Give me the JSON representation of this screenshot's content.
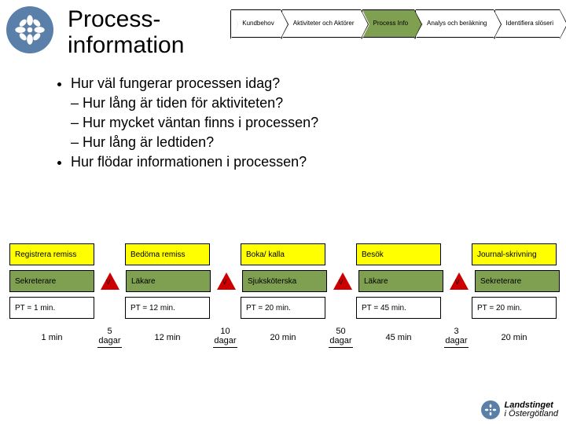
{
  "title_line1": "Process-",
  "title_line2": "information",
  "nav": {
    "step1": "Kundbehov",
    "step2": "Aktiviteter och Aktörer",
    "step3": "Process Info",
    "step4": "Analys och beräkning",
    "step5": "Identifiera slöseri"
  },
  "bullets": {
    "q1": "Hur väl fungerar processen idag?",
    "q1a": "Hur lång är tiden för aktiviteten?",
    "q1b": "Hur mycket väntan finns i processen?",
    "q1c": "Hur lång är ledtiden?",
    "q2": "Hur flödar informationen i processen?"
  },
  "flow": {
    "headers": [
      "Registrera remiss",
      "Bedöma remiss",
      "Boka/ kalla",
      "Besök",
      "Journal-skrivning"
    ],
    "actors": [
      "Sekreterare",
      "Läkare",
      "Sjuksköterska",
      "Läkare",
      "Sekreterare"
    ],
    "pt": [
      "PT = 1 min.",
      "PT = 12 min.",
      "PT = 20 min.",
      "PT = 45 min.",
      "PT = 20 min."
    ],
    "pt_short": [
      "1 min",
      "12 min",
      "20 min",
      "45 min",
      "20 min"
    ],
    "wait": [
      "5 dagar",
      "10 dagar",
      "50 dagar",
      "3 dagar"
    ],
    "v": "V"
  },
  "footer": {
    "brand": "Landstinget",
    "region": "i Östergötland"
  }
}
